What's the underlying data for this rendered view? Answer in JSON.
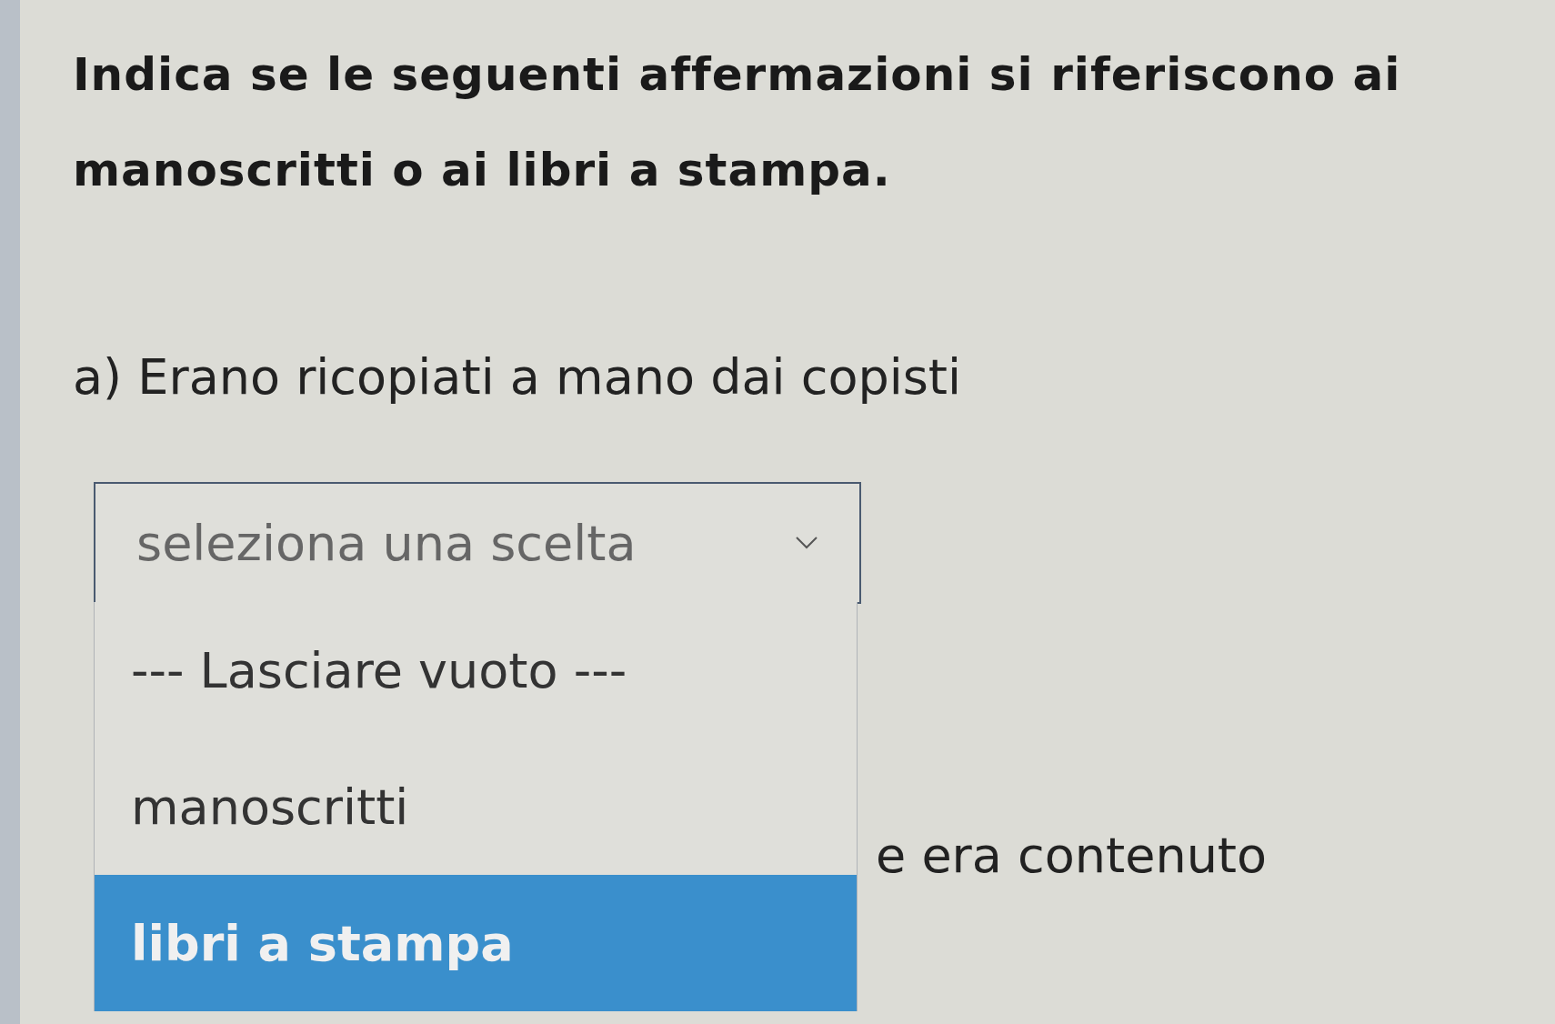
{
  "instruction": "Indica se le seguenti affermazioni si riferiscono ai manoscritti o ai libri a stampa.",
  "question": "a) Erano ricopiati a mano dai copisti",
  "select": {
    "placeholder": "seleziona una scelta",
    "expanded": true
  },
  "options": [
    {
      "label": "--- Lasciare vuoto ---",
      "selected": false
    },
    {
      "label": "manoscritti",
      "selected": false
    },
    {
      "label": "libri a stampa",
      "selected": true
    }
  ],
  "next_text": "e era contenuto"
}
